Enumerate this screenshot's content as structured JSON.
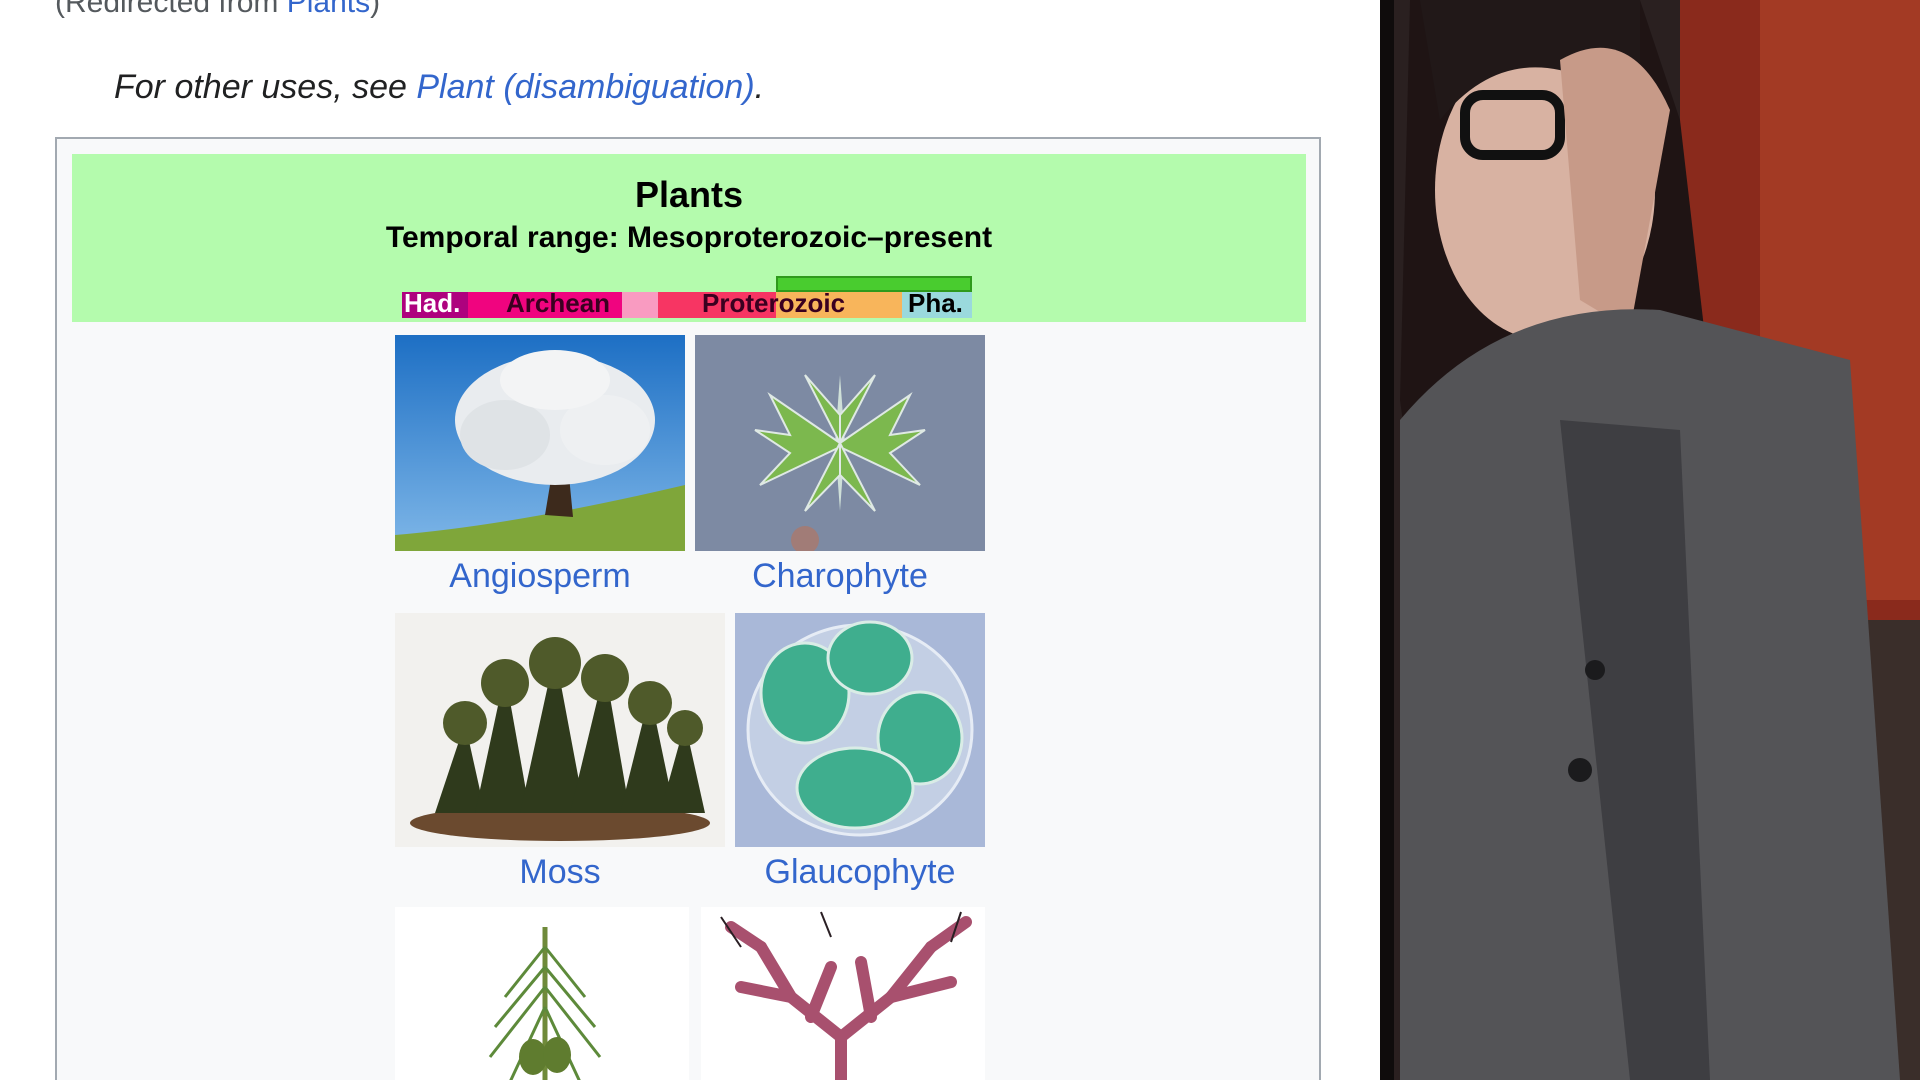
{
  "redirect": {
    "prefix": "(Redirected from ",
    "link": "Plants",
    "suffix": ")"
  },
  "hatnote": {
    "prefix": "For other uses, see ",
    "link": "Plant (disambiguation)",
    "suffix": "."
  },
  "infobox": {
    "title": "Plants",
    "temporal_range": "Temporal range: Mesoproterozoic–present",
    "timeline": {
      "labels": [
        "Had.",
        "Archean",
        "Proterozoic",
        "Pha."
      ],
      "colors": {
        "hadean": "#ae027e",
        "archean": "#f0047f",
        "archean_light": "#f99bc1",
        "proterozoic": "#f73563",
        "proterozoic_range": "#f8b55b",
        "phanerozoic": "#9ad9dd",
        "range_bar": "#49cc2f"
      }
    },
    "gallery": [
      {
        "caption": "Angiosperm",
        "image": "tree-photo"
      },
      {
        "caption": "Charophyte",
        "image": "charophyte-micrograph"
      },
      {
        "caption": "Moss",
        "image": "moss-illustration"
      },
      {
        "caption": "Glaucophyte",
        "image": "glaucophyte-micrograph"
      },
      {
        "caption": "",
        "image": "pine-illustration"
      },
      {
        "caption": "",
        "image": "red-algae-illustration"
      }
    ]
  },
  "colors": {
    "link": "#3366cc",
    "header_bg": "#b4fbad",
    "infobox_bg": "#f8f9fa",
    "border": "#a2a9b1"
  }
}
